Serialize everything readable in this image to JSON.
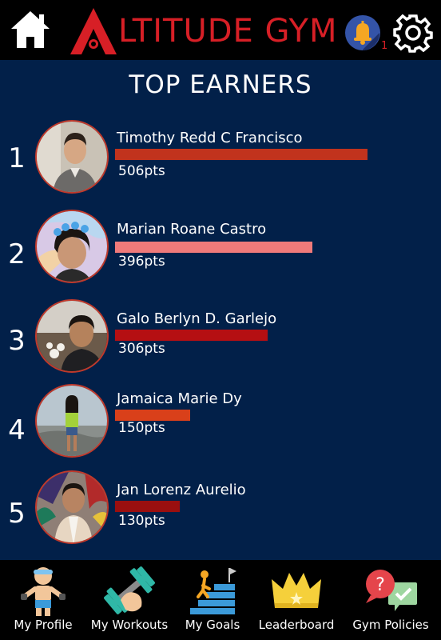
{
  "header": {
    "brand_letter": "A",
    "brand_text": "LTITUDE GYM",
    "notification_count": "1",
    "icons": {
      "home": "home-icon",
      "bell": "bell-icon",
      "gear": "gear-icon"
    },
    "brand_color": "#d71f26"
  },
  "page_title": "TOP EARNERS",
  "leaderboard": [
    {
      "rank": "1",
      "name": "Timothy Redd C Francisco",
      "points": "506pts",
      "score": 506,
      "bar_color": "#c1331d"
    },
    {
      "rank": "2",
      "name": "Marian Roane Castro",
      "points": "396pts",
      "score": 396,
      "bar_color": "#f07a7a"
    },
    {
      "rank": "3",
      "name": "Galo Berlyn D. Garlejo",
      "points": "306pts",
      "score": 306,
      "bar_color": "#b50f12"
    },
    {
      "rank": "4",
      "name": "Jamaica Marie Dy",
      "points": "150pts",
      "score": 150,
      "bar_color": "#d9401a"
    },
    {
      "rank": "5",
      "name": "Jan Lorenz Aurelio",
      "points": "130pts",
      "score": 130,
      "bar_color": "#9a0f0f"
    }
  ],
  "bottom_nav": [
    {
      "label": "My Profile",
      "icon": "profile-icon"
    },
    {
      "label": "My Workouts",
      "icon": "dumbbell-icon"
    },
    {
      "label": "My Goals",
      "icon": "stairs-goal-icon"
    },
    {
      "label": "Leaderboard",
      "icon": "crown-icon"
    },
    {
      "label": "Gym Policies",
      "icon": "policies-icon"
    }
  ],
  "colors": {
    "background": "#022049",
    "bars_bg": "#000000"
  }
}
